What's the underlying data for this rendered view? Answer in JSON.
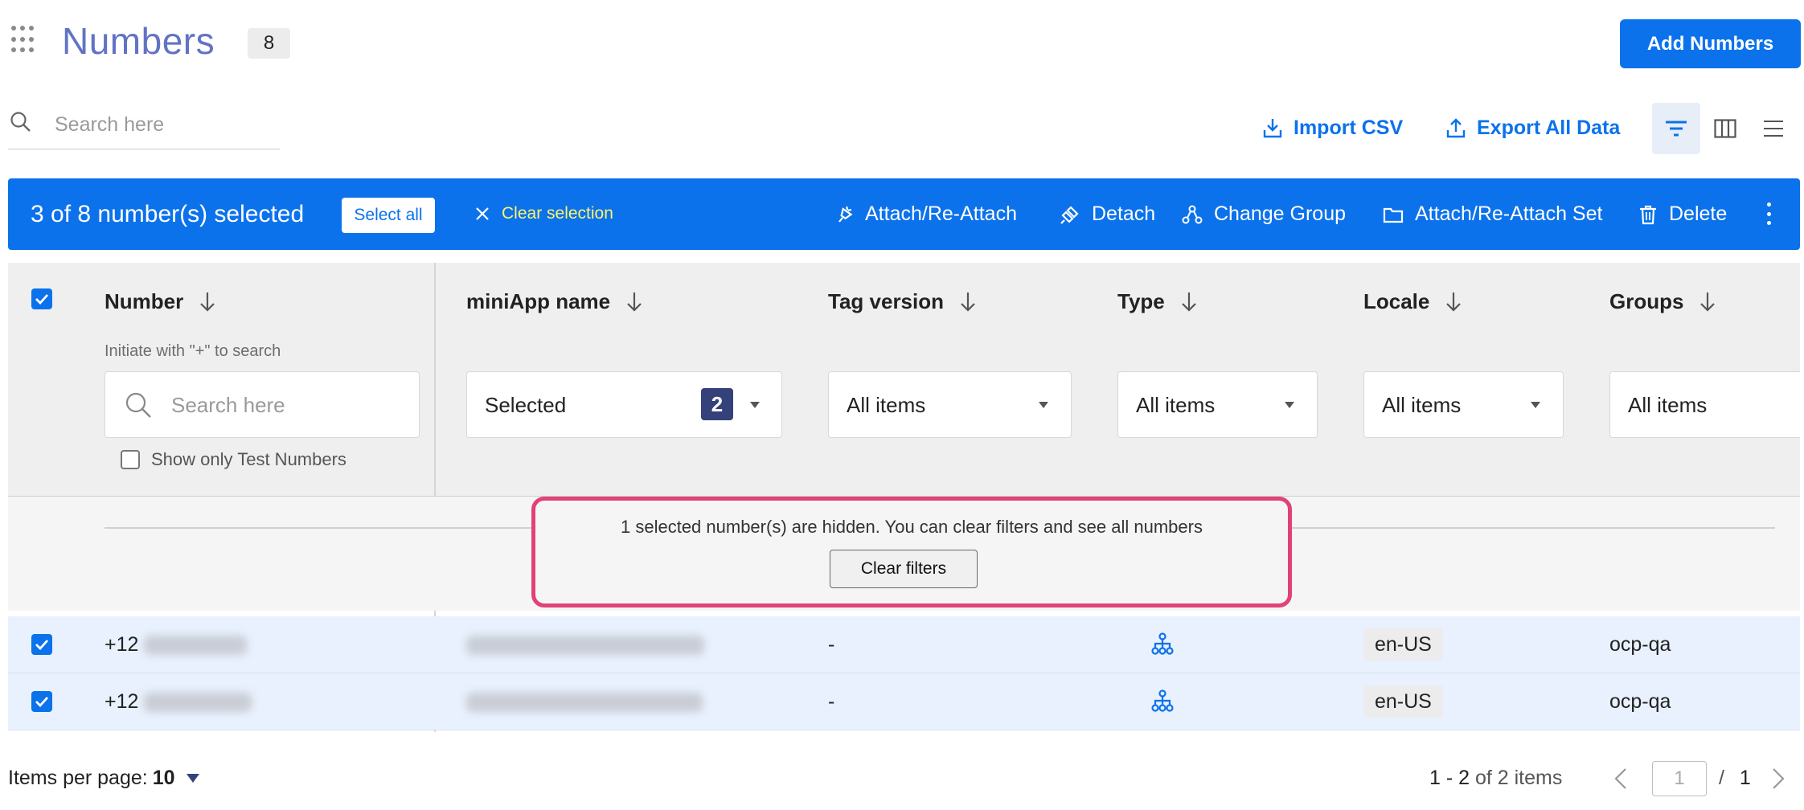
{
  "header": {
    "title": "Numbers",
    "count": "8",
    "add_button": "Add Numbers"
  },
  "search": {
    "placeholder": "Search here"
  },
  "toolbar": {
    "import_csv": "Import CSV",
    "export_all": "Export All Data"
  },
  "selection_bar": {
    "text": "3 of 8 number(s) selected",
    "select_all": "Select all",
    "clear_selection": "Clear selection",
    "actions": [
      "Attach/Re-Attach",
      "Detach",
      "Change Group",
      "Attach/Re-Attach Set",
      "Delete"
    ]
  },
  "table": {
    "columns": [
      "Number",
      "miniApp name",
      "Tag version",
      "Type",
      "Locale",
      "Groups"
    ],
    "number_hint": "Initiate with \"+\" to search",
    "number_search_placeholder": "Search here",
    "show_test_numbers": "Show only Test Numbers",
    "filters": {
      "miniapp": {
        "value": "Selected",
        "count": "2"
      },
      "tag_version": "All items",
      "type": "All items",
      "locale": "All items",
      "groups": "All items"
    },
    "hidden_message": "1 selected number(s) are hidden. You can clear filters and see all numbers",
    "clear_filters": "Clear filters",
    "rows": [
      {
        "number_prefix": "+12",
        "tag_version": "-",
        "type_icon": "network-icon",
        "locale": "en-US",
        "group": "ocp-qa"
      },
      {
        "number_prefix": "+12",
        "tag_version": "-",
        "type_icon": "network-icon",
        "locale": "en-US",
        "group": "ocp-qa"
      }
    ]
  },
  "footer": {
    "items_per_page_label": "Items per page:",
    "items_per_page": "10",
    "range": "1 - 2",
    "range_suffix": "of 2 items",
    "page": "1",
    "page_sep": "/",
    "total_pages": "1"
  },
  "colors": {
    "primary": "#0b72ec",
    "title": "#6173c4",
    "highlight": "#e0427a",
    "row_selected": "#e8f1fd"
  }
}
